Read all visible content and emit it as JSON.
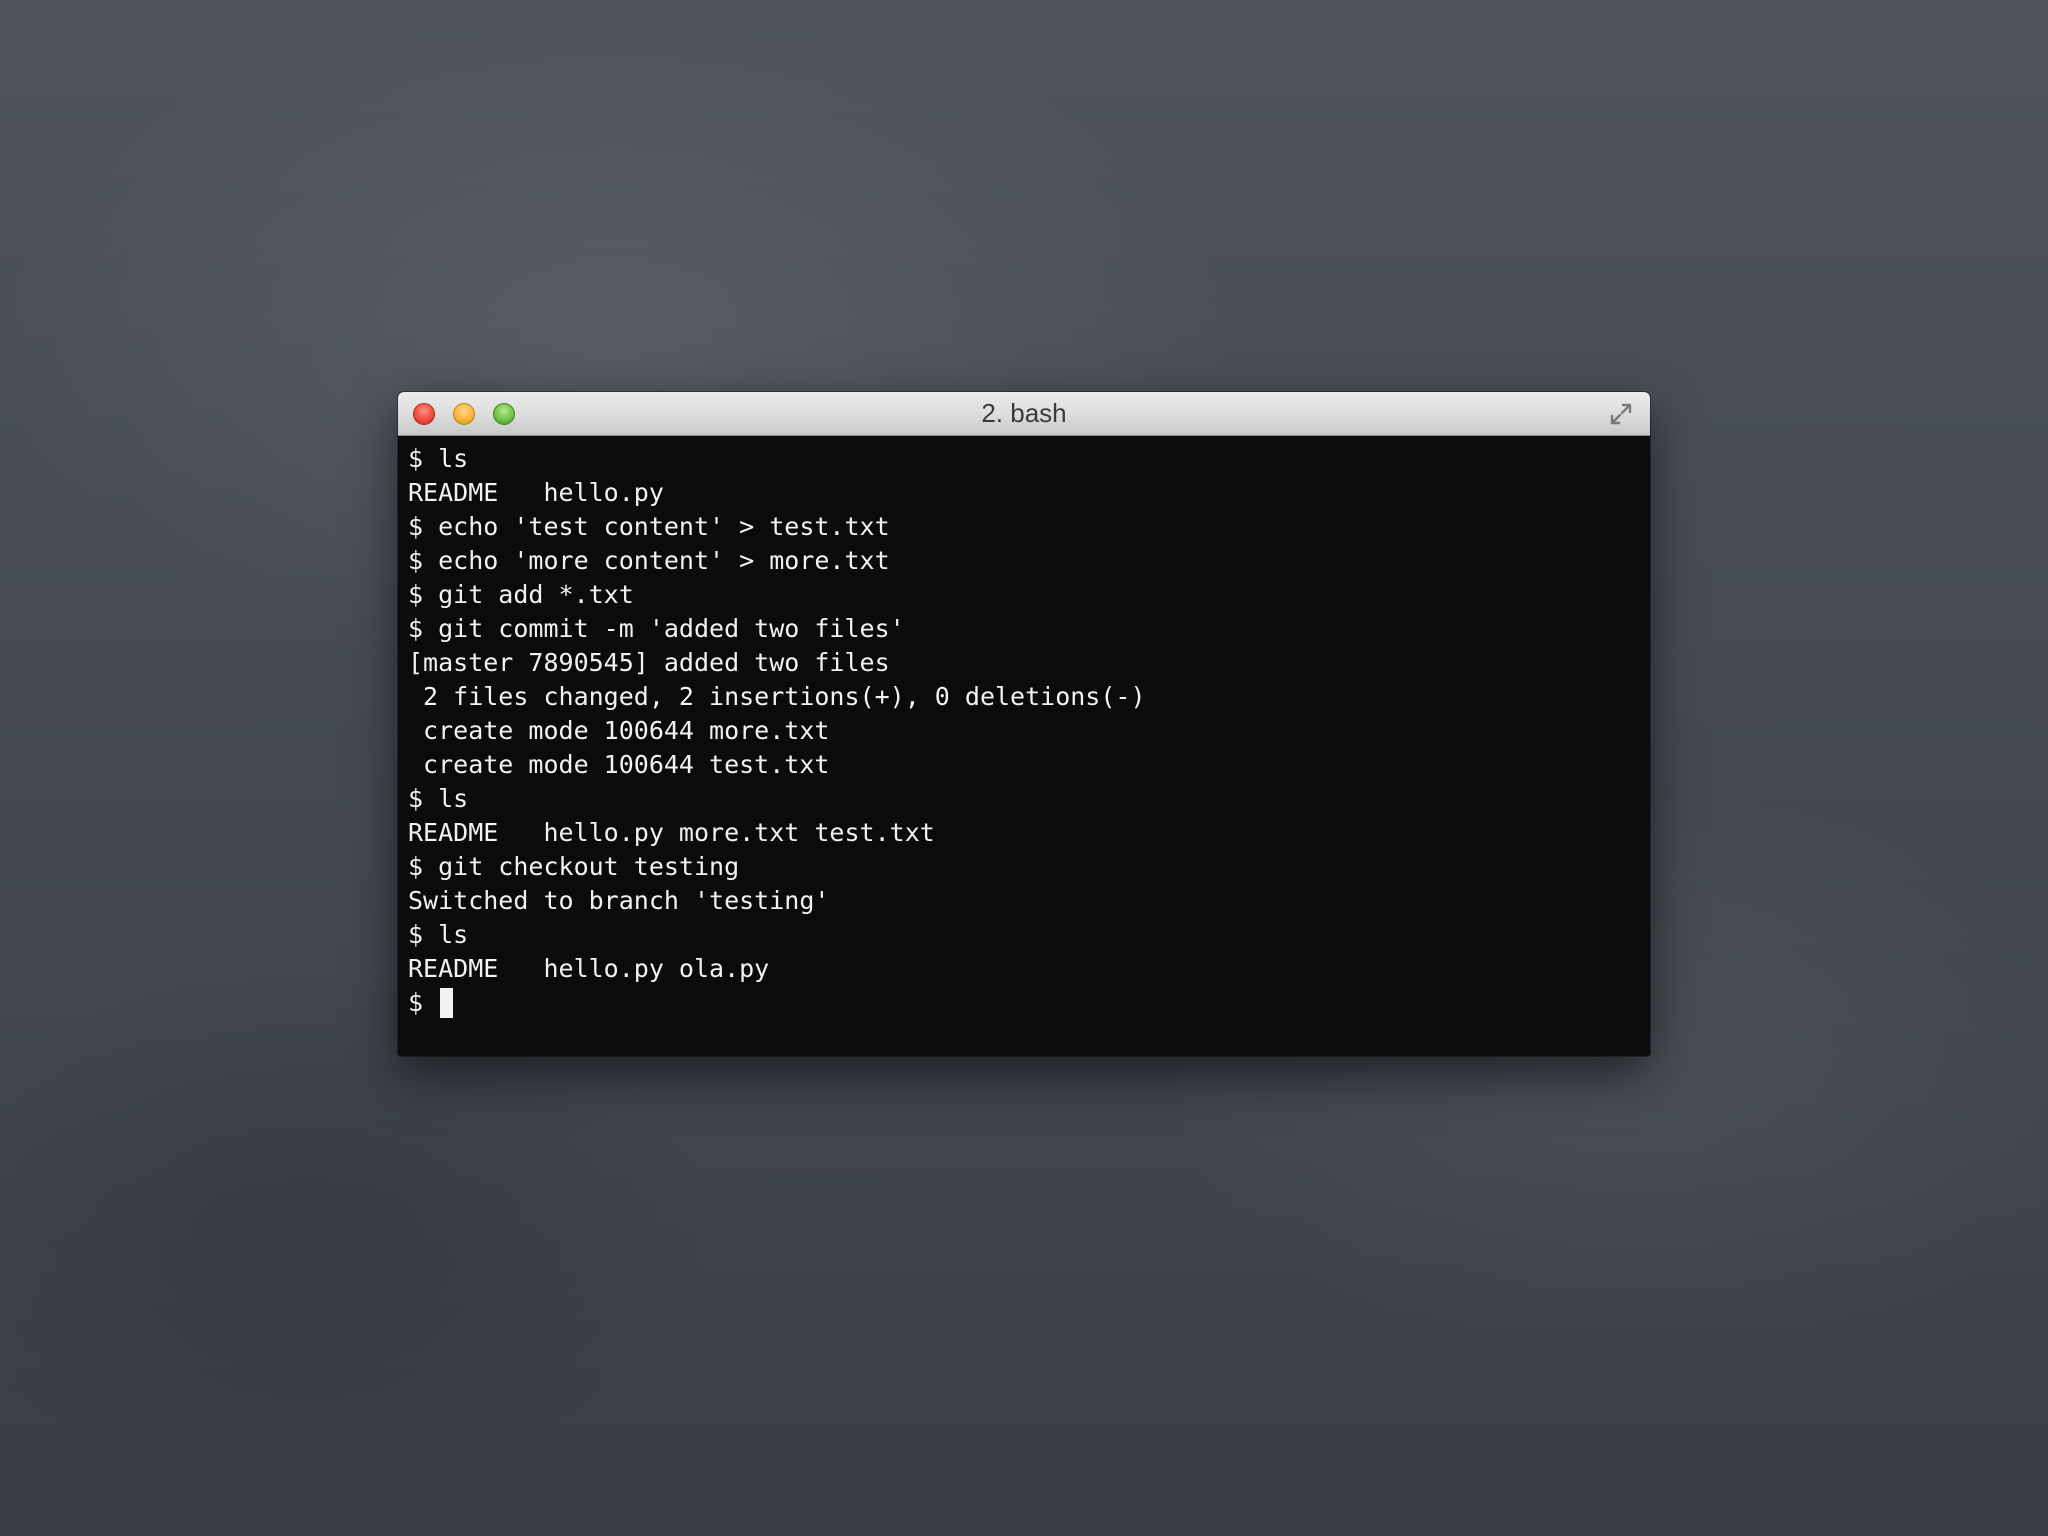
{
  "window": {
    "title": "2. bash"
  },
  "icons": {
    "close": "close-button-icon",
    "minimize": "minimize-button-icon",
    "zoom": "zoom-button-icon",
    "fullscreen": "fullscreen-arrows-icon"
  },
  "colors": {
    "terminal_background": "#0b0b0b",
    "terminal_text": "#f2f2f2",
    "close": "#f04b3f",
    "minimize": "#f6b43a",
    "zoom": "#6fc148"
  },
  "terminal": {
    "lines": [
      "$ ls",
      "README   hello.py",
      "$ echo 'test content' > test.txt",
      "$ echo 'more content' > more.txt",
      "$ git add *.txt",
      "$ git commit -m 'added two files'",
      "[master 7890545] added two files",
      " 2 files changed, 2 insertions(+), 0 deletions(-)",
      " create mode 100644 more.txt",
      " create mode 100644 test.txt",
      "$ ls",
      "README   hello.py more.txt test.txt",
      "$ git checkout testing",
      "Switched to branch 'testing'",
      "$ ls",
      "README   hello.py ola.py"
    ],
    "prompt": "$ "
  }
}
